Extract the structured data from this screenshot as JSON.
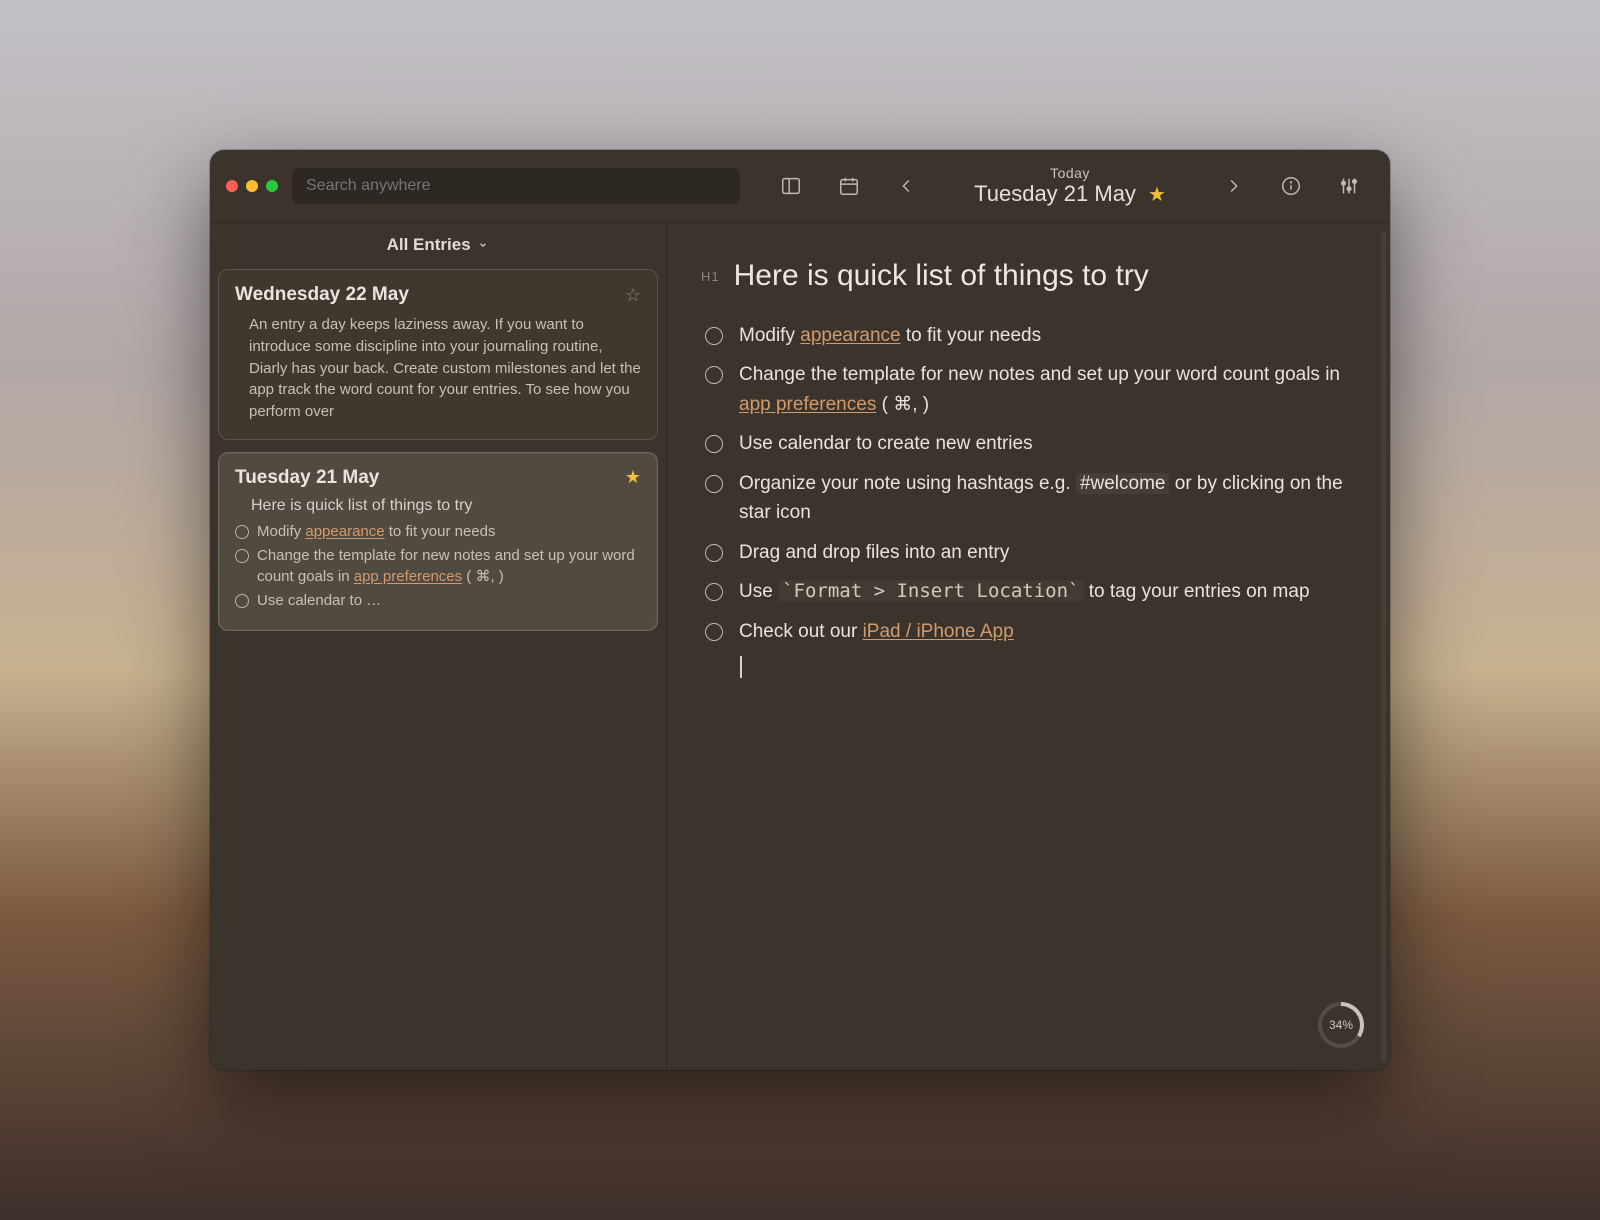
{
  "header": {
    "search_placeholder": "Search anywhere",
    "today_label": "Today",
    "date": "Tuesday 21 May"
  },
  "sidebar": {
    "filter": "All Entries",
    "entries": [
      {
        "title": "Wednesday 22 May",
        "starred": false,
        "preview": "An entry a day keeps laziness away. If you want to introduce some discipline into your journaling routine, Diarly has your back. Create custom milestones and let the app track the word count for your entries. To see how you perform over"
      },
      {
        "title": "Tuesday 21 May",
        "starred": true,
        "subtitle": "Here is quick list of things to try",
        "items": [
          {
            "pre": "Modify ",
            "link": "appearance",
            "post": " to fit your needs"
          },
          {
            "pre": "Change the template for new notes and set up your word count goals in ",
            "link": "app preferences",
            "post": " ( ⌘, )"
          },
          {
            "pre": "Use calendar to …",
            "link": "",
            "post": ""
          }
        ]
      }
    ]
  },
  "main": {
    "heading_tag": "H1",
    "heading": "Here is quick list of things to try",
    "todos": [
      {
        "parts": [
          {
            "t": "Modify "
          },
          {
            "t": "appearance",
            "link": true
          },
          {
            "t": " to fit your needs"
          }
        ]
      },
      {
        "parts": [
          {
            "t": "Change the template for new notes and set up your word count goals in "
          },
          {
            "t": "app preferences",
            "link": true
          },
          {
            "t": " ( ⌘, )"
          }
        ]
      },
      {
        "parts": [
          {
            "t": "Use calendar to create new entries"
          }
        ]
      },
      {
        "parts": [
          {
            "t": "Organize your note using hashtags e.g. "
          },
          {
            "t": "#welcome",
            "tag": true
          },
          {
            "t": " or by clicking on the star icon"
          }
        ]
      },
      {
        "parts": [
          {
            "t": "Drag and drop files into an entry"
          }
        ]
      },
      {
        "parts": [
          {
            "t": "Use "
          },
          {
            "t": "`Format > Insert Location`",
            "code": true
          },
          {
            "t": " to tag your entries on map"
          }
        ]
      },
      {
        "parts": [
          {
            "t": "Check out our "
          },
          {
            "t": "iPad / iPhone App",
            "link": true
          }
        ]
      }
    ],
    "progress": "34%"
  }
}
